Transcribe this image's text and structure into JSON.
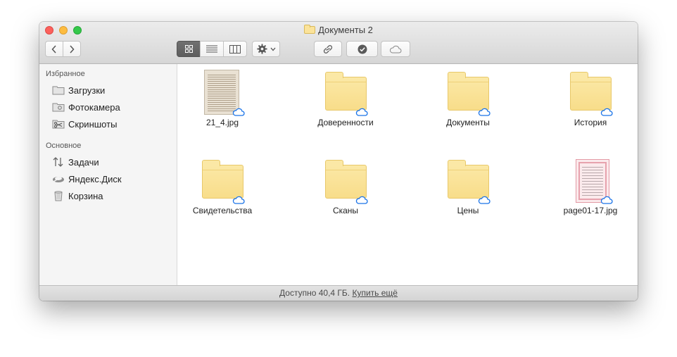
{
  "window": {
    "title": "Документы 2",
    "title_icon": "folder-icon"
  },
  "toolbar": {
    "back_icon": "chevron-left-icon",
    "forward_icon": "chevron-right-icon",
    "view_modes": [
      {
        "name": "icon-view",
        "icon": "grid-icon",
        "active": true
      },
      {
        "name": "list-view",
        "icon": "list-icon",
        "active": false
      },
      {
        "name": "column-view",
        "icon": "columns-icon",
        "active": false
      }
    ],
    "action_icon": "gear-icon",
    "share_link_icon": "link-icon",
    "check_icon": "checkmark-circle-icon",
    "cloud_icon": "cloud-icon"
  },
  "sidebar": {
    "sections": [
      {
        "header": "Избранное",
        "items": [
          {
            "label": "Загрузки",
            "icon": "folder-icon"
          },
          {
            "label": "Фотокамера",
            "icon": "camera-folder-icon"
          },
          {
            "label": "Скриншоты",
            "icon": "scissors-folder-icon"
          }
        ]
      },
      {
        "header": "Основное",
        "items": [
          {
            "label": "Задачи",
            "icon": "transfer-arrows-icon"
          },
          {
            "label": "Яндекс.Диск",
            "icon": "yandex-disk-icon"
          },
          {
            "label": "Корзина",
            "icon": "trash-icon"
          }
        ]
      }
    ]
  },
  "files": [
    {
      "name": "21_4.jpg",
      "kind": "image-document",
      "synced": true
    },
    {
      "name": "Доверенности",
      "kind": "folder",
      "synced": true
    },
    {
      "name": "Документы",
      "kind": "folder",
      "synced": true
    },
    {
      "name": "История",
      "kind": "folder",
      "synced": true
    },
    {
      "name": "Свидетельства",
      "kind": "folder",
      "synced": true
    },
    {
      "name": "Сканы",
      "kind": "folder",
      "synced": true
    },
    {
      "name": "Цены",
      "kind": "folder",
      "synced": true
    },
    {
      "name": "page01-17.jpg",
      "kind": "image-certificate",
      "synced": true
    }
  ],
  "status": {
    "available": "Доступно 40,4 ГБ.",
    "buy_more": "Купить ещё"
  },
  "colors": {
    "folder_fill": "#f8dd8a",
    "cloud_accent": "#1a73e8",
    "close": "#fc605c",
    "minimize": "#fdbc40",
    "maximize": "#34c84a"
  }
}
